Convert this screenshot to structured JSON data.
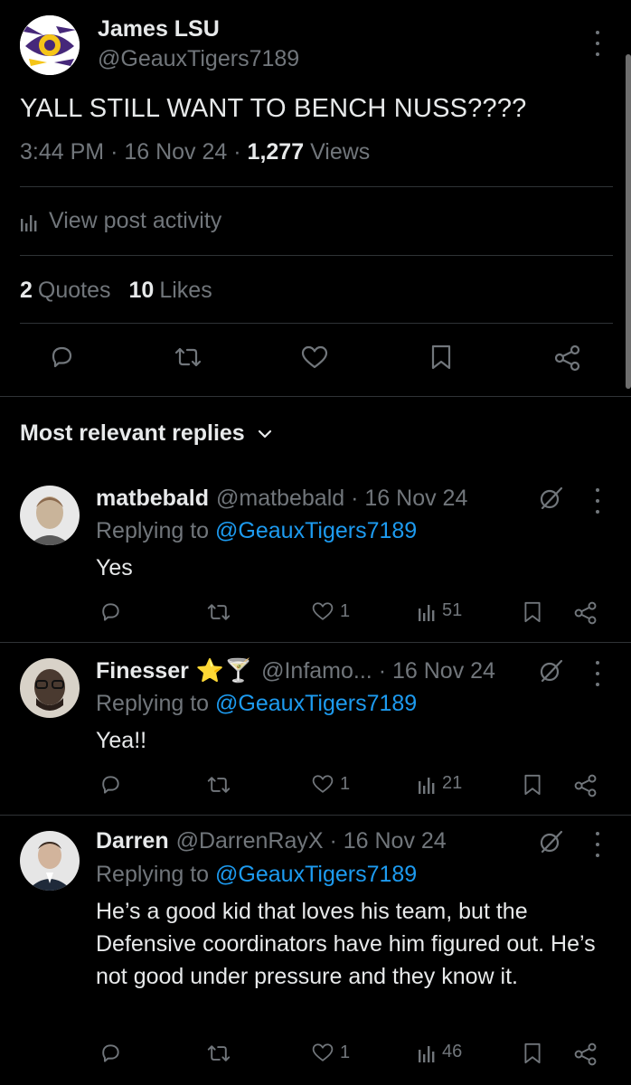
{
  "post": {
    "author_name": "James LSU",
    "author_handle": "@GeauxTigers7189",
    "text": "YALL STILL WANT TO BENCH NUSS????",
    "time": "3:44 PM",
    "date": "16 Nov 24",
    "views_count": "1,277",
    "views_label": "Views",
    "activity_label": "View post activity",
    "quotes_count": "2",
    "quotes_label": "Quotes",
    "likes_count": "10",
    "likes_label": "Likes"
  },
  "sort_label": "Most relevant replies",
  "replies": [
    {
      "name": "matbebald",
      "handle": "@matbebald",
      "date": "16 Nov 24",
      "replying_prefix": "Replying to",
      "replying_to": "@GeauxTigers7189",
      "text": "Yes",
      "likes": "1",
      "views": "51",
      "avatar_color": "#c9b49a"
    },
    {
      "name": "Finesser",
      "emoji": "⭐🍸",
      "handle": "@Infamo...",
      "date": "16 Nov 24",
      "replying_prefix": "Replying to",
      "replying_to": "@GeauxTigers7189",
      "text": "Yea!!",
      "likes": "1",
      "views": "21",
      "avatar_color": "#4a3a30"
    },
    {
      "name": "Darren",
      "handle": "@DarrenRayX",
      "date": "16 Nov 24",
      "replying_prefix": "Replying to",
      "replying_to": "@GeauxTigers7189",
      "text": "He’s a good kid that loves his team, but the Defensive coordinators have him figured out. He’s not good under pressure and they know it.",
      "likes": "1",
      "views": "46",
      "avatar_color": "#b8a899"
    }
  ],
  "colors": {
    "background": "#000000",
    "text": "#e7e9ea",
    "muted": "#71767b",
    "link": "#1d9bf0",
    "divider": "#2f3336",
    "lsu_purple": "#46287a",
    "lsu_gold": "#f5c518"
  },
  "icons": [
    "reply-icon",
    "retweet-icon",
    "like-icon",
    "bookmark-icon",
    "share-icon",
    "views-icon",
    "grok-icon",
    "more-icon",
    "chevron-down-icon"
  ]
}
